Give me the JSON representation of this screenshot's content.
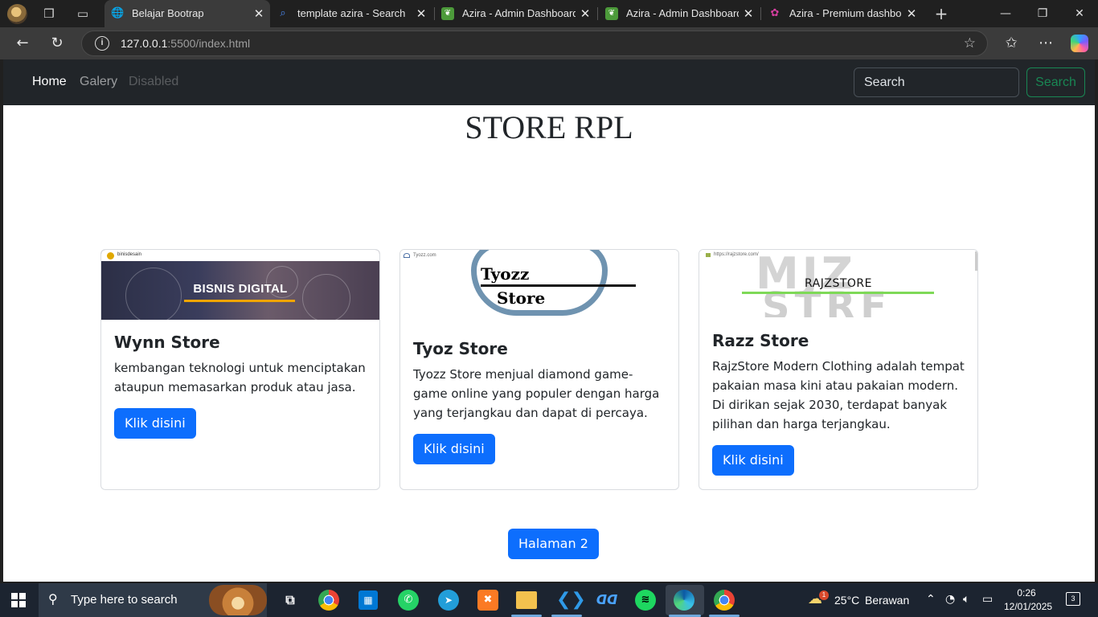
{
  "browser": {
    "tabs": [
      {
        "title": "Belajar Bootrap",
        "active": true,
        "icon": "globe-icon"
      },
      {
        "title": "template azira - Search",
        "active": false,
        "icon": "search-icon"
      },
      {
        "title": "Azira - Admin Dashboard H",
        "active": false,
        "icon": "azira-leaf-icon"
      },
      {
        "title": "Azira - Admin Dashboard H",
        "active": false,
        "icon": "azira-leaf-icon"
      },
      {
        "title": "Azira - Premium dashboard",
        "active": false,
        "icon": "azira-premium-icon"
      }
    ],
    "url_host": "127.0.0.1",
    "url_rest": ":5500/index.html"
  },
  "navbar": {
    "links": [
      "Home",
      "Galery",
      "Disabled"
    ],
    "search_placeholder": "Search",
    "search_button": "Search"
  },
  "page": {
    "title": "STORE RPL",
    "cards": [
      {
        "title": "Wynn Store",
        "text": "kembangan teknologi untuk menciptakan ataupun memasarkan produk atau jasa.",
        "button": "Klik disini",
        "image_text": "BISNIS DIGITAL",
        "image_site": "binisdesain"
      },
      {
        "title": "Tyoz Store",
        "text": "Tyozz Store menjual diamond game-game online yang populer dengan harga yang terjangkau dan dapat di percaya.",
        "button": "Klik disini",
        "image_text_1": "Tyozz",
        "image_text_2": "Store",
        "image_site": "Tyozz.com"
      },
      {
        "title": "Razz Store",
        "text": "RajzStore Modern Clothing adalah tempat pakaian masa kini atau pakaian modern. Di dirikan sejak 2030, terdapat banyak pilihan dan harga terjangkau.",
        "button": "Klik disini",
        "image_text": "RAJZSTORE",
        "image_site": "https://rajzstore.com/"
      }
    ],
    "page_button": "Halaman 2"
  },
  "taskbar": {
    "search_placeholder": "Type here to search",
    "weather_temp": "25°C",
    "weather_desc": "Berawan",
    "weather_badge": "1",
    "time": "0:26",
    "date": "12/01/2025",
    "notification_count": "3",
    "apps": [
      "task-view-icon",
      "chrome-icon",
      "store-icon",
      "whatsapp-icon",
      "telegram-icon",
      "xampp-icon",
      "file-explorer-icon",
      "vscode-icon",
      "app-icon",
      "spotify-icon",
      "edge-icon",
      "chrome-icon"
    ]
  },
  "colors": {
    "primary": "#0d6efd",
    "navbar_bg": "#212529",
    "success": "#198754"
  }
}
